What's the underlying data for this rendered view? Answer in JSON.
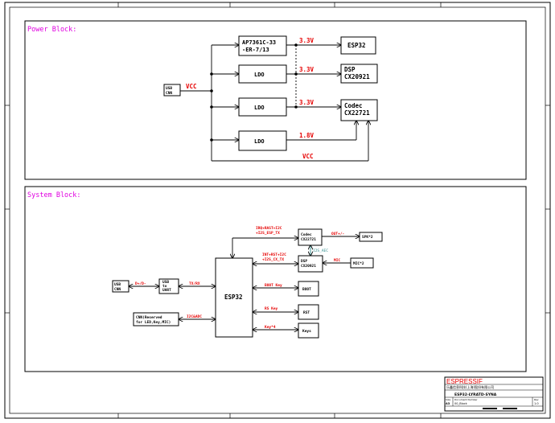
{
  "power": {
    "title": "Power Block:",
    "usb": [
      "USB",
      "CNN"
    ],
    "vcc_in": "VCC",
    "ap_block": [
      "AP7361C-33",
      "-ER-7/13"
    ],
    "ldo": "LDO",
    "v33": "3.3V",
    "v18": "1.8V",
    "vcc_bottom": "VCC",
    "esp32": "ESP32",
    "dsp": [
      "DSP",
      "CX20921"
    ],
    "codec": [
      "Codec",
      "CX22721"
    ]
  },
  "system": {
    "title": "System Block:",
    "usb": [
      "USB",
      "CNN"
    ],
    "dpdm": "D+/D-",
    "usb_uart": [
      "USB",
      "to",
      "UART"
    ],
    "txrx": "TX/RX",
    "cnn_reserved": [
      "CNN(Reserved",
      "for LED,Key,MIC)"
    ],
    "i2c_adc": "I2C&ADC",
    "esp32": "ESP32",
    "codec": [
      "Codec",
      "CX22721"
    ],
    "codec_bus": [
      "IRQ+RAST+I2C",
      "+I2S_ESP_TX"
    ],
    "out": "OUT+/-",
    "spk": "SPK*2",
    "i2s_aec": "I2S_AEC",
    "dsp": [
      "DSP",
      "CX20921"
    ],
    "dsp_bus": [
      "INT+RST+I2C",
      "+I2S_CX_TX"
    ],
    "mic_label": "MIC",
    "mic_box": "MIC*2",
    "boot_key": "BOOT Key",
    "boot": "BOOT",
    "rs_key": "RS Key",
    "rst": "RST",
    "key4": "Key*4",
    "keys": "Keys"
  },
  "title_block": {
    "logo": "ESPRESSIF",
    "company": "乐鑫信息科技(上海)股份有限公司",
    "project": "ESP32-LYRATD-SYNA",
    "sheet_name": "00_Block",
    "size_hdr": "Size",
    "size_val": "A3",
    "doc_hdr": "Document Number",
    "rev_hdr": "Rev",
    "rev_val": "1.0"
  }
}
